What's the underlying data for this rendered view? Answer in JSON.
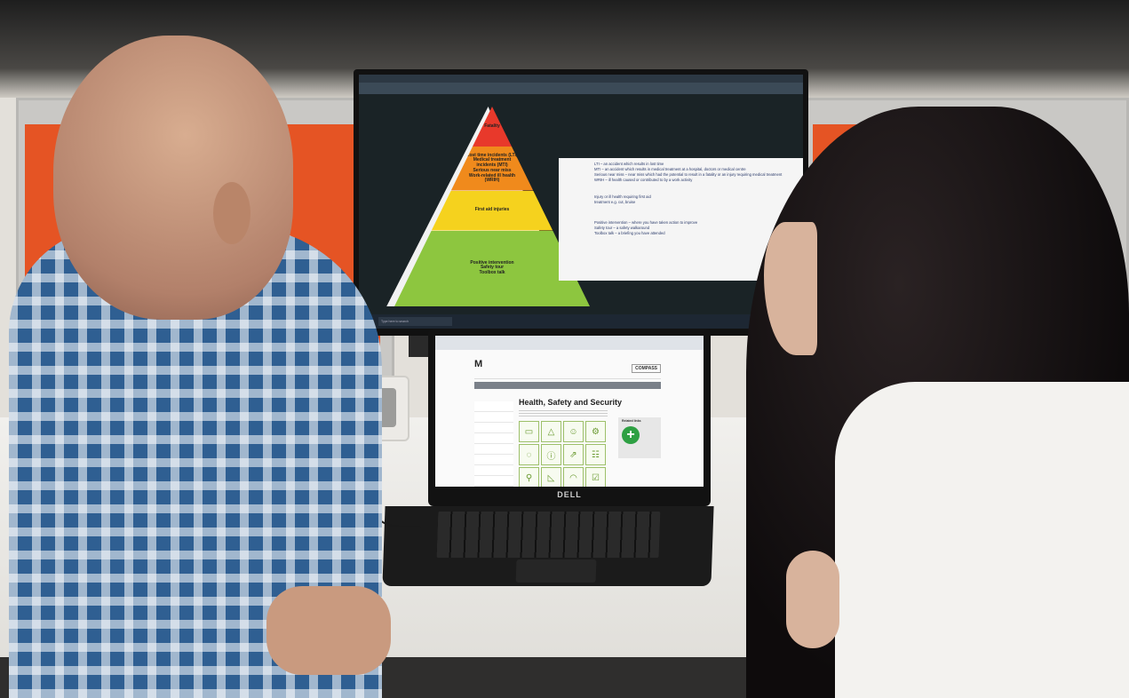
{
  "scene": {
    "description_hidden": ""
  },
  "monitor": {
    "pyramid": [
      {
        "label": "Fatality",
        "color": "#e8392b"
      },
      {
        "label": "Lost time incidents (LTI)\nMedical treatment\nincidents (MTI)\nSerious near miss\nWork-related ill health\n(WRIH)",
        "color": "#f08a1c"
      },
      {
        "label": "First aid injuries",
        "color": "#f5d21e"
      },
      {
        "label": "Positive intervention\nSafety tour\nToolbox talk",
        "color": "#8dc63f"
      }
    ],
    "descriptions": [
      "LTI – an accident which results in lost time",
      "MTI – an accident which results in medical treatment at a hospital, doctors or medical centre",
      "Serious near miss – near miss which had the potential to result in a fatality or an injury requiring medical treatment",
      "WRIH – ill health caused or contributed to by a work activity",
      "Injury or ill health requiring first aid",
      "treatment e.g. cut, bruise",
      "Positive intervention – where you have taken action to improve",
      "Safety tour – a safety walkaround",
      "Toolbox talk – a briefing you have attended"
    ],
    "taskbar_search": "Type here to search"
  },
  "laptop": {
    "brand": "DELL",
    "logo": "M",
    "compass": "COMPASS",
    "page_title": "Health, Safety and Security",
    "related_title": "Related links",
    "tiles": [
      "▭",
      "△",
      "☺",
      "⚙",
      "◌",
      "ⓘ",
      "⇗",
      "☷",
      "⚲",
      "◺",
      "◠",
      "☑"
    ]
  },
  "colors": {
    "partition_orange": "#e55424",
    "shirt_blue": "#2f5f92"
  }
}
